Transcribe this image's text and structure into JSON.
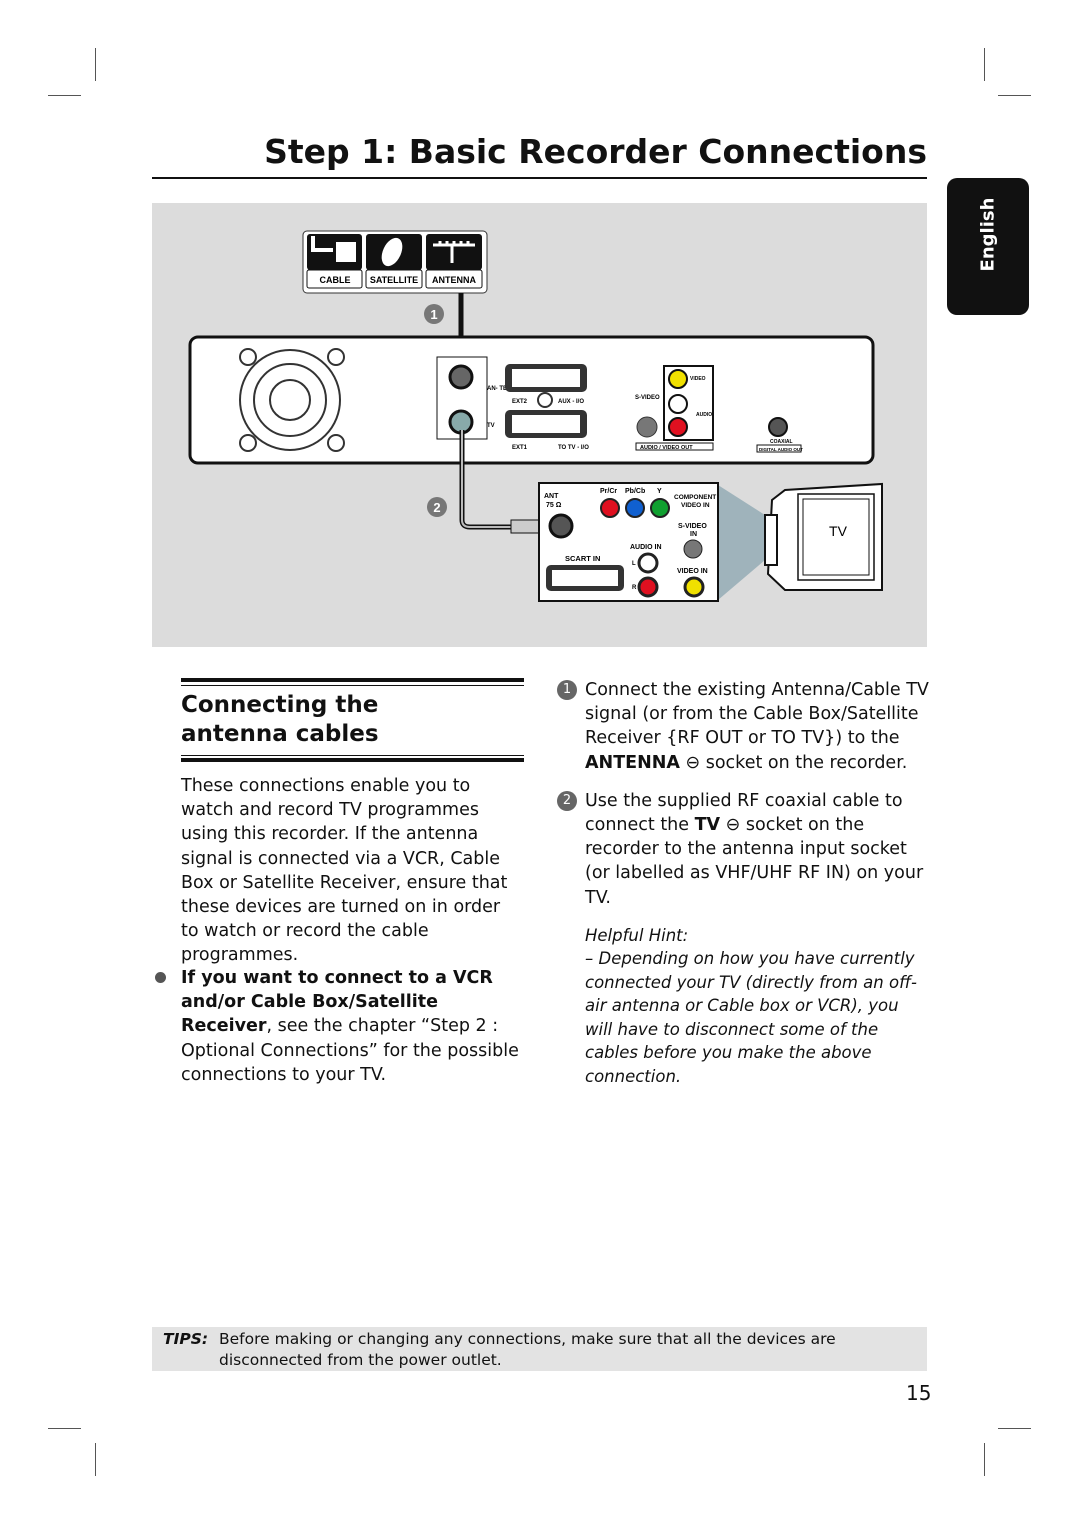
{
  "header": {
    "title": "Step 1: Basic Recorder Connections",
    "language_tab": "English"
  },
  "diagram": {
    "sources": [
      "CABLE",
      "SATELLITE",
      "ANTENNA"
    ],
    "callouts": [
      "1",
      "2"
    ],
    "recorder": {
      "antenna_label": "AN-\nTENNA",
      "tv_label": "TV",
      "ext2": "EXT2",
      "aux": "AUX - I/O",
      "ext1": "EXT1",
      "to_tv": "TO TV - I/O",
      "svideo": "S-VIDEO",
      "svideo_sub": "(Y/C)",
      "video": "VIDEO",
      "video_sub": "(CVBS)",
      "audio": "AUDIO",
      "av_out": "AUDIO / VIDEO OUT",
      "coaxial": "COAXIAL",
      "digital_out": "DIGITAL AUDIO OUT"
    },
    "tv_panel": {
      "ant": "ANT",
      "ohm": "75 Ω",
      "pr": "Pr/Cr",
      "pb": "Pb/Cb",
      "y": "Y",
      "component": "COMPONENT",
      "video_in_c": "VIDEO IN",
      "svideo": "S-VIDEO",
      "svideo_in": "IN",
      "audio_in": "AUDIO IN",
      "l": "L",
      "r": "R",
      "scart": "SCART IN",
      "video_in": "VIDEO IN"
    },
    "tv_label": "TV",
    "colors": {
      "background": "#dcdcdc",
      "red": "#e01020",
      "blue": "#1060d0",
      "green": "#10a030",
      "yellow": "#f0e000",
      "beam": "#9fb3bb"
    }
  },
  "left": {
    "heading": "Connecting the antenna cables",
    "paragraph": "These connections enable you to watch and record TV programmes using this recorder. If the antenna signal is connected via a VCR, Cable Box or Satellite Receiver, ensure that these devices are turned on in order to watch or record the cable programmes.",
    "bullet_bold": "If you want to connect to a VCR and/or Cable Box/Satellite Receiver",
    "bullet_rest": ", see the chapter “Step 2 : Optional Connections” for the possible connections to your TV."
  },
  "right": {
    "steps": [
      {
        "num": "1",
        "pre": "Connect the existing Antenna/Cable TV signal (or from the Cable Box/Satellite Receiver {RF OUT or TO TV}) to the ",
        "bold": "ANTENNA",
        "post": " socket on the recorder."
      },
      {
        "num": "2",
        "pre": "Use the supplied RF coaxial cable to connect the ",
        "bold": "TV",
        "post": " socket on the recorder to the antenna input socket (or labelled as VHF/UHF RF IN) on your TV."
      }
    ],
    "hint_title": "Helpful Hint:",
    "hint_text": "– Depending on how you have currently connected your TV (directly from an off-air antenna or Cable box or VCR), you will have to disconnect some of the cables before you make the above connection."
  },
  "tips": {
    "label": "TIPS:",
    "text": "Before making or changing any connections, make sure that all the devices are disconnected from the power outlet."
  },
  "page_number": "15"
}
